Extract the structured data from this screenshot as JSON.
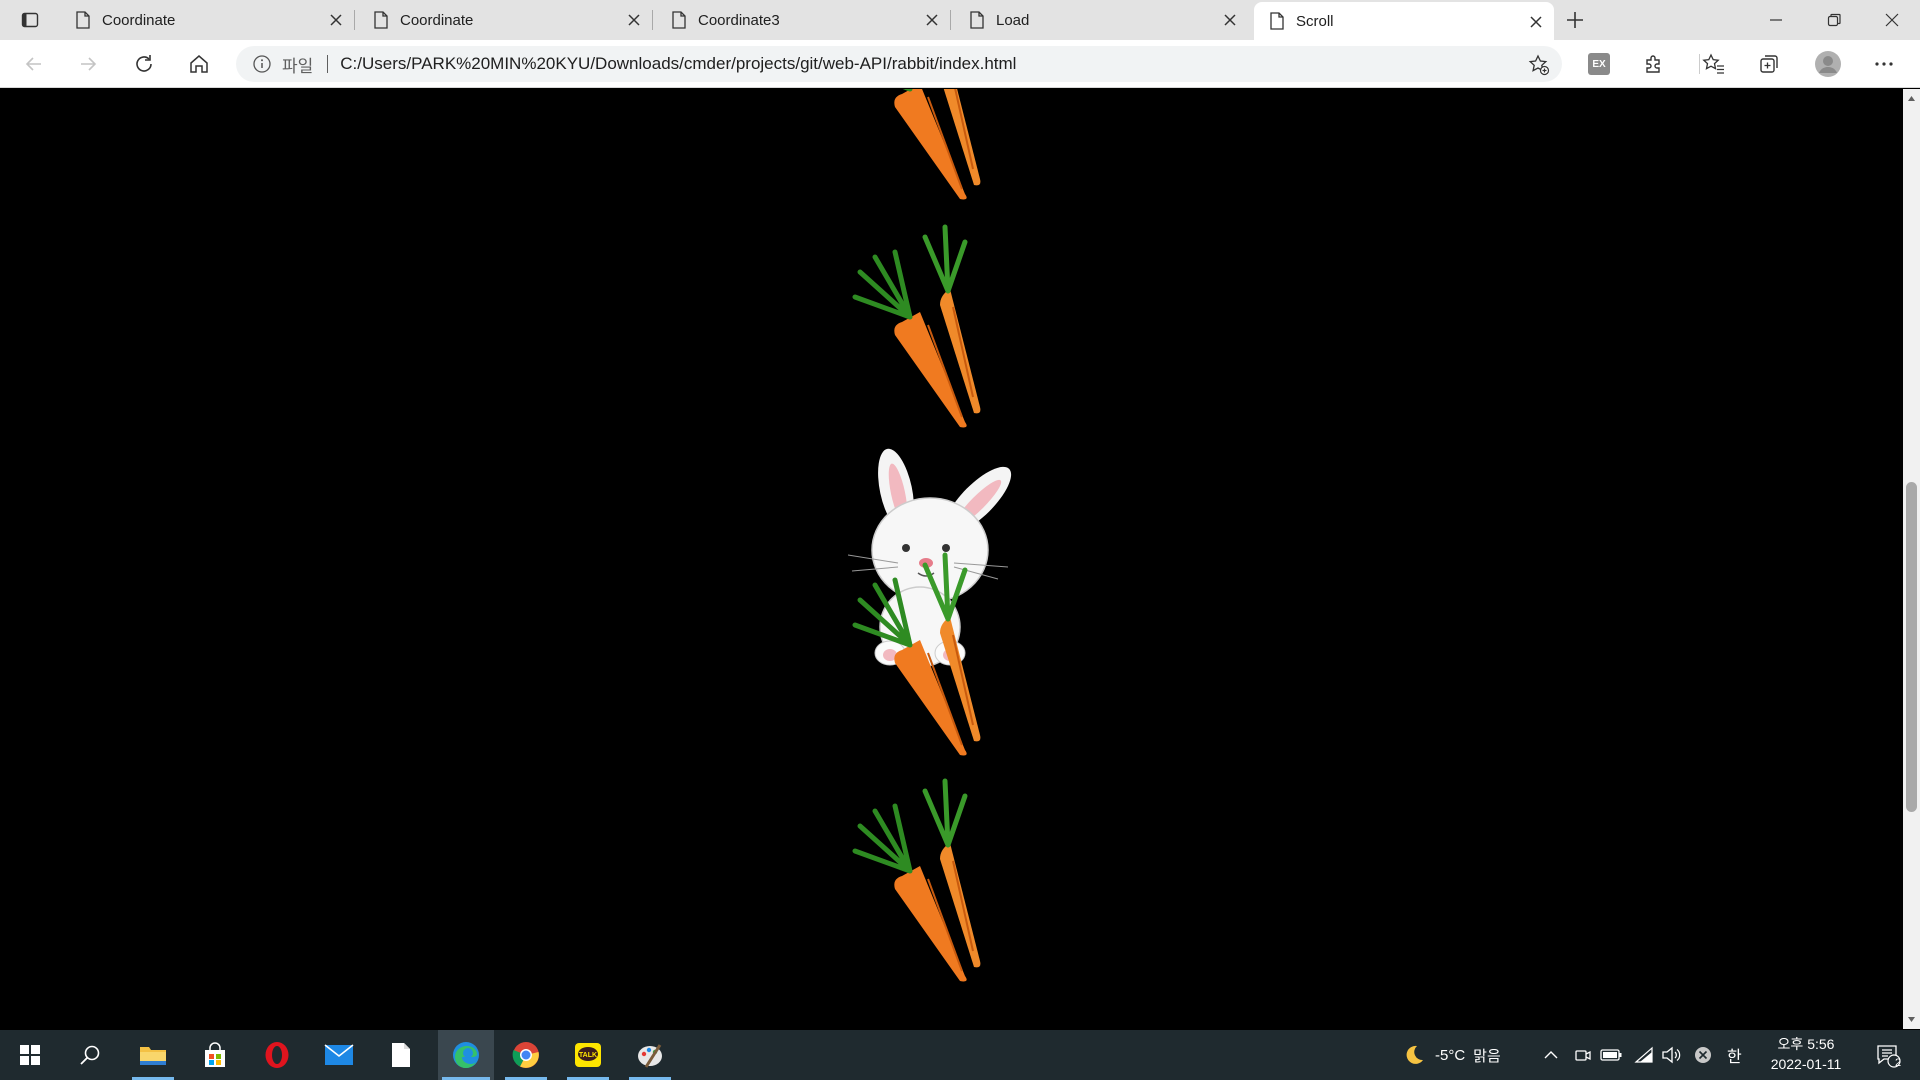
{
  "browser": {
    "tabs": [
      {
        "title": "Coordinate",
        "active": false
      },
      {
        "title": "Coordinate",
        "active": false
      },
      {
        "title": "Coordinate3",
        "active": false
      },
      {
        "title": "Load",
        "active": false
      },
      {
        "title": "Scroll",
        "active": true
      }
    ],
    "address": {
      "protocol_label": "파일",
      "url": "C:/Users/PARK%20MIN%20KYU/Downloads/cmder/projects/git/web-API/rabbit/index.html"
    },
    "extension_badge": "EX"
  },
  "page": {
    "background": "#000000",
    "images": [
      "carrot",
      "carrot",
      "rabbit",
      "carrot",
      "carrot"
    ]
  },
  "taskbar": {
    "apps": [
      "start",
      "search",
      "file-explorer",
      "store",
      "opera",
      "mail",
      "notepad",
      "edge",
      "chrome",
      "kakaotalk",
      "paint"
    ],
    "weather": {
      "temp": "-5°C",
      "condition": "맑음"
    },
    "ime": "한",
    "clock": {
      "ampm_time": "오후 5:56",
      "date": "2022-01-11"
    },
    "notification_count": "2"
  },
  "colors": {
    "tab_strip": "#e3e3e3",
    "taskbar": "#1f2a2f",
    "accent": "#76b9ed"
  }
}
